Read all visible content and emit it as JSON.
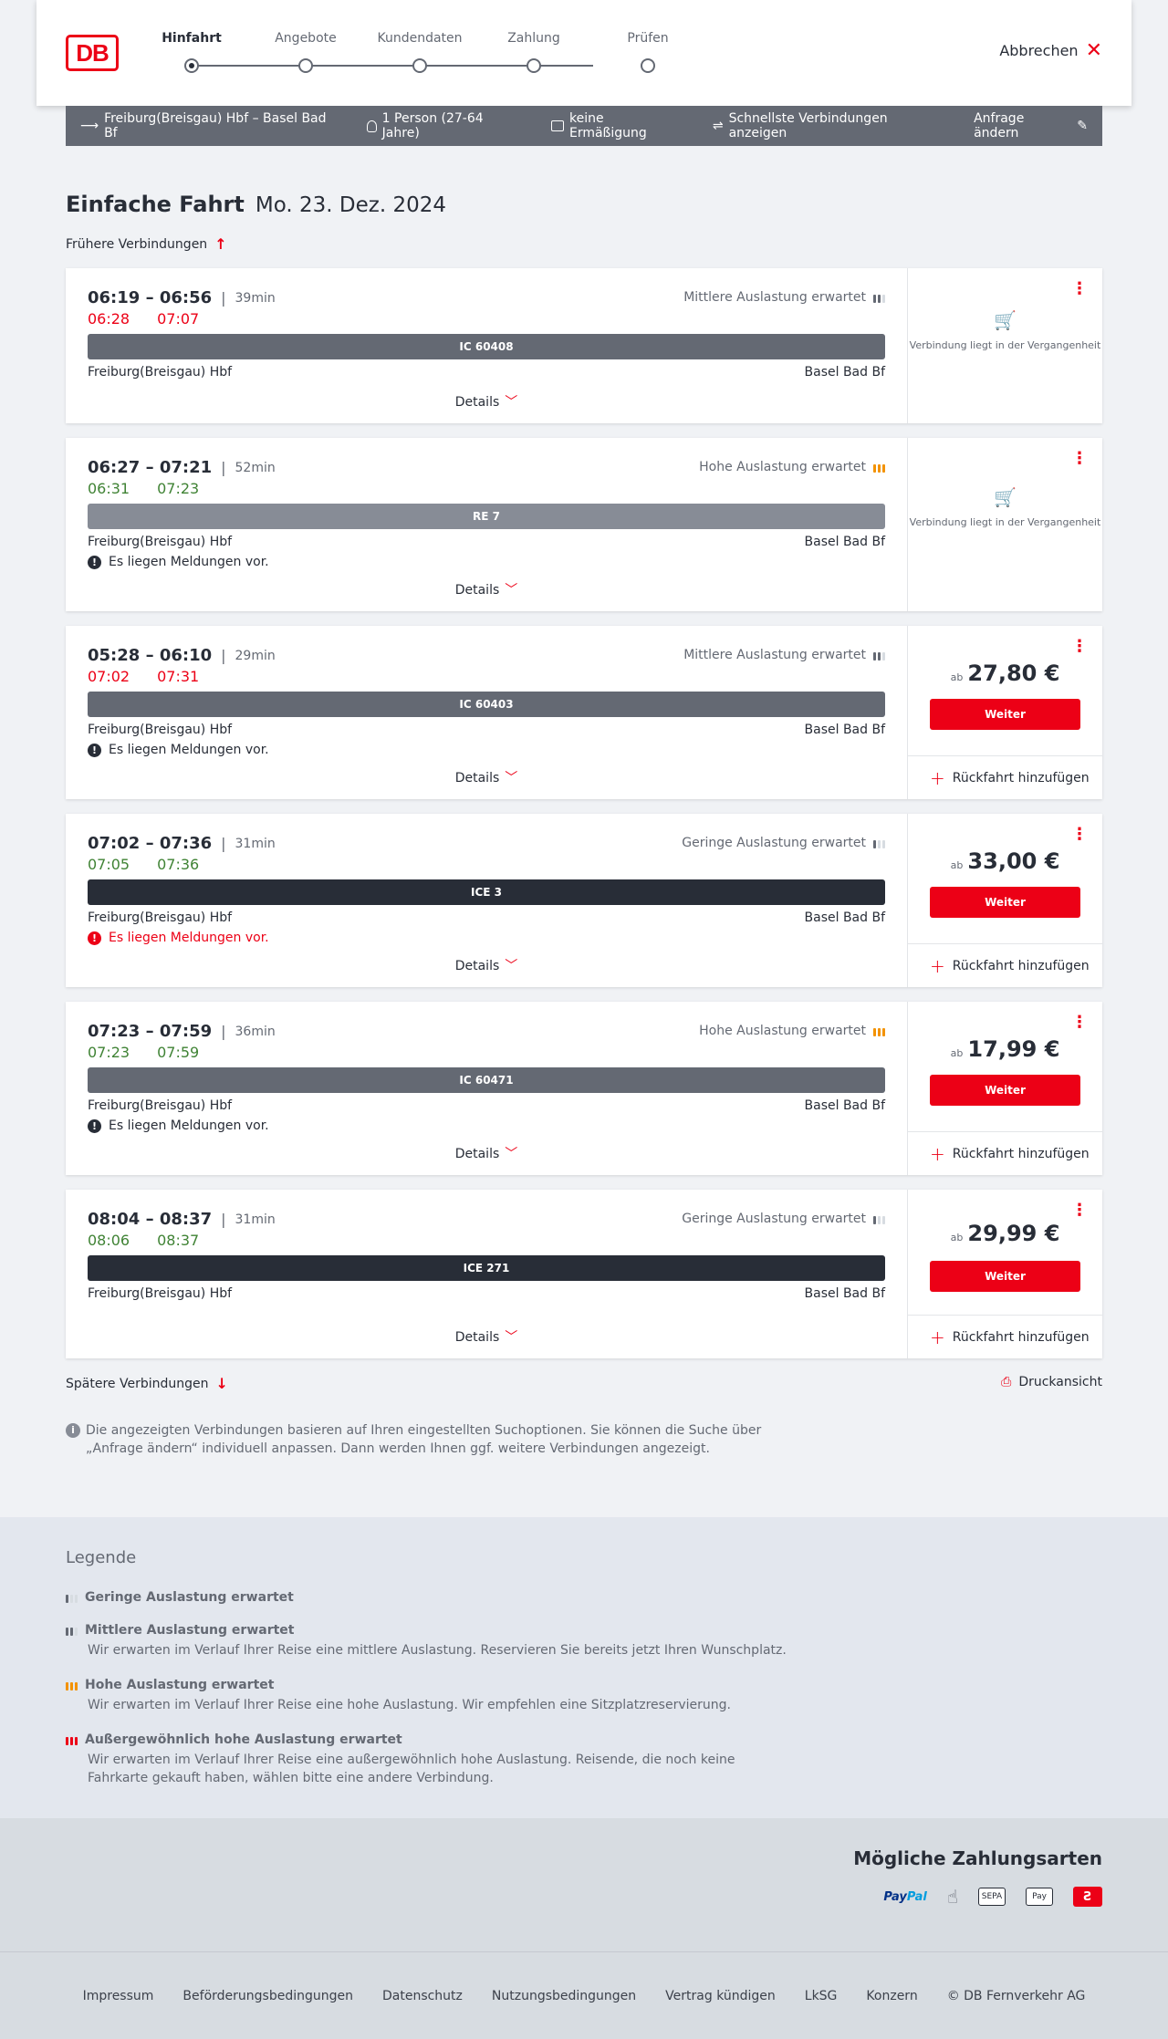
{
  "header": {
    "logo": "DB",
    "steps": [
      "Hinfahrt",
      "Angebote",
      "Kundendaten",
      "Zahlung",
      "Prüfen"
    ],
    "cancel_label": "Abbrechen"
  },
  "searchbar": {
    "route": "Freiburg(Breisgau) Hbf – Basel Bad Bf",
    "persons": "1 Person (27-64 Jahre)",
    "discount": "keine Ermäßigung",
    "fastest": "Schnellste Verbindungen anzeigen",
    "edit": "Anfrage ändern"
  },
  "title": {
    "trip": "Einfache Fahrt",
    "date": "Mo. 23. Dez. 2024"
  },
  "earlier": "Frühere Verbindungen",
  "later": "Spätere Verbindungen",
  "print": "Druckansicht",
  "details_label": "Details",
  "weiter_label": "Weiter",
  "return_label": "Rückfahrt hinzufügen",
  "past_label": "Verbindung liegt in der Vergangenheit",
  "connections": [
    {
      "time": "06:19 – 06:56",
      "duration": "39min",
      "rt_dep": "06:28",
      "rt_arr": "07:07",
      "rt_color": "red",
      "load": "Mittlere Auslastung erwartet",
      "train": "IC 60408",
      "from": "Freiburg(Breisgau) Hbf",
      "to": "Basel Bad Bf"
    },
    {
      "time": "06:27 – 07:21",
      "duration": "52min",
      "rt_dep": "06:31",
      "rt_arr": "07:23",
      "rt_color": "green",
      "load": "Hohe Auslastung erwartet",
      "train": "RE 7",
      "from": "Freiburg(Breisgau) Hbf",
      "to": "Basel Bad Bf",
      "message": "Es liegen Meldungen vor."
    },
    {
      "time": "05:28 – 06:10",
      "duration": "29min",
      "rt_dep": "07:02",
      "rt_arr": "07:31",
      "rt_color": "red",
      "load": "Mittlere Auslastung erwartet",
      "train": "IC 60403",
      "from": "Freiburg(Breisgau) Hbf",
      "to": "Basel Bad Bf",
      "message": "Es liegen Meldungen vor.",
      "price_prefix": "ab",
      "price": "27,80 €"
    },
    {
      "time": "07:02 – 07:36",
      "duration": "31min",
      "rt_dep": "07:05",
      "rt_arr": "07:36",
      "rt_color": "green",
      "load": "Geringe Auslastung erwartet",
      "train": "ICE 3",
      "from": "Freiburg(Breisgau) Hbf",
      "to": "Basel Bad Bf",
      "message": "Es liegen Meldungen vor.",
      "price_prefix": "ab",
      "price": "33,00 €"
    },
    {
      "time": "07:23 – 07:59",
      "duration": "36min",
      "rt_dep": "07:23",
      "rt_arr": "07:59",
      "rt_color": "green",
      "load": "Hohe Auslastung erwartet",
      "train": "IC 60471",
      "from": "Freiburg(Breisgau) Hbf",
      "to": "Basel Bad Bf",
      "message": "Es liegen Meldungen vor.",
      "price_prefix": "ab",
      "price": "17,99 €"
    },
    {
      "time": "08:04 – 08:37",
      "duration": "31min",
      "rt_dep": "08:06",
      "rt_arr": "08:37",
      "rt_color": "green",
      "load": "Geringe Auslastung erwartet",
      "train": "ICE 271",
      "from": "Freiburg(Breisgau) Hbf",
      "to": "Basel Bad Bf",
      "price_prefix": "ab",
      "price": "29,99 €"
    }
  ],
  "info_text": "Die angezeigten Verbindungen basieren auf Ihren eingestellten Suchoptionen. Sie können die Suche über „Anfrage ändern“ individuell anpassen. Dann werden Ihnen ggf. weitere Verbindungen angezeigt.",
  "legend": {
    "title": "Legende",
    "items": [
      {
        "title": "Geringe Auslastung erwartet",
        "text": ""
      },
      {
        "title": "Mittlere Auslastung erwartet",
        "text": "Wir erwarten im Verlauf Ihrer Reise eine mittlere Auslastung. Reservieren Sie bereits jetzt Ihren Wunschplatz."
      },
      {
        "title": "Hohe Auslastung erwartet",
        "text": "Wir erwarten im Verlauf Ihrer Reise eine hohe Auslastung. Wir empfehlen eine Sitzplatzreservierung."
      },
      {
        "title": "Außergewöhnlich hohe Auslastung erwartet",
        "text": "Wir erwarten im Verlauf Ihrer Reise eine außergewöhnlich hohe Auslastung. Reisende, die noch keine Fahrkarte gekauft haben, wählen bitte eine andere Verbindung."
      }
    ]
  },
  "payment": {
    "title": "Mögliche Zahlungsarten",
    "paypal_a": "Pay",
    "paypal_b": "Pal",
    "sepa": "SEPA",
    "applepay": "Pay"
  },
  "footer": [
    "Impressum",
    "Beförderungsbedingungen",
    "Datenschutz",
    "Nutzungsbedingungen",
    "Vertrag kündigen",
    "LkSG",
    "Konzern",
    "© DB Fernverkehr AG"
  ],
  "colors": {
    "accent": "#ec0016",
    "delay": "#ec0016",
    "ontime": "#408335",
    "high_load": "#f39200"
  }
}
